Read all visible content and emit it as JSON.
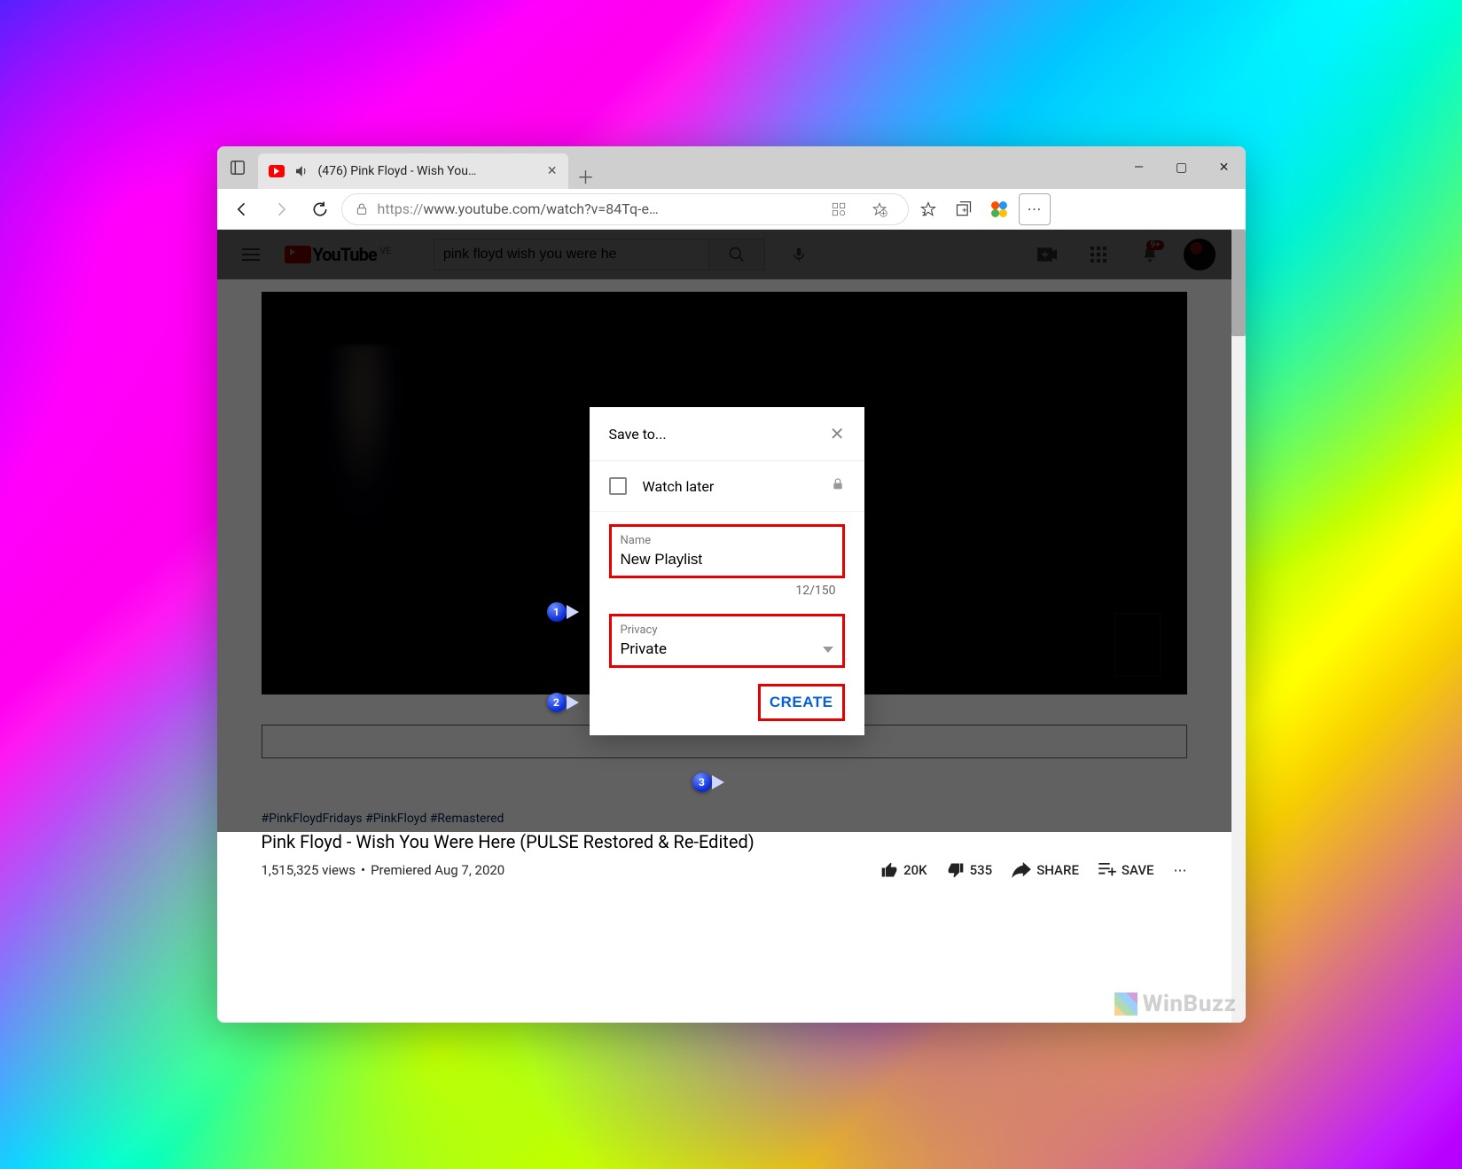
{
  "browser": {
    "tab_title": "(476) Pink Floyd - Wish You…",
    "url_display": "https://www.youtube.com/watch?v=84Tq-e…",
    "url_proto": "https://",
    "url_rest": "www.youtube.com/watch?v=84Tq-e…"
  },
  "youtube": {
    "logo_text": "YouTube",
    "logo_region": "VE",
    "search_value": "pink floyd wish you were he",
    "notif_count": "9+"
  },
  "video_info": {
    "hashtags": "#PinkFloydFridays #PinkFloyd #Remastered",
    "title": "Pink Floyd - Wish You Were Here (PULSE Restored & Re-Edited)",
    "views": "1,515,325 views",
    "dot": "•",
    "date": "Premiered Aug 7, 2020",
    "likes": "20K",
    "dislikes": "535",
    "share": "SHARE",
    "save": "SAVE"
  },
  "dialog": {
    "title": "Save to...",
    "watch_later": "Watch later",
    "name_label": "Name",
    "name_value": "New Playlist",
    "name_counter": "12/150",
    "privacy_label": "Privacy",
    "privacy_value": "Private",
    "create": "CREATE"
  },
  "callouts": {
    "one": "1",
    "two": "2",
    "three": "3"
  },
  "watermark": "WinBuzz"
}
